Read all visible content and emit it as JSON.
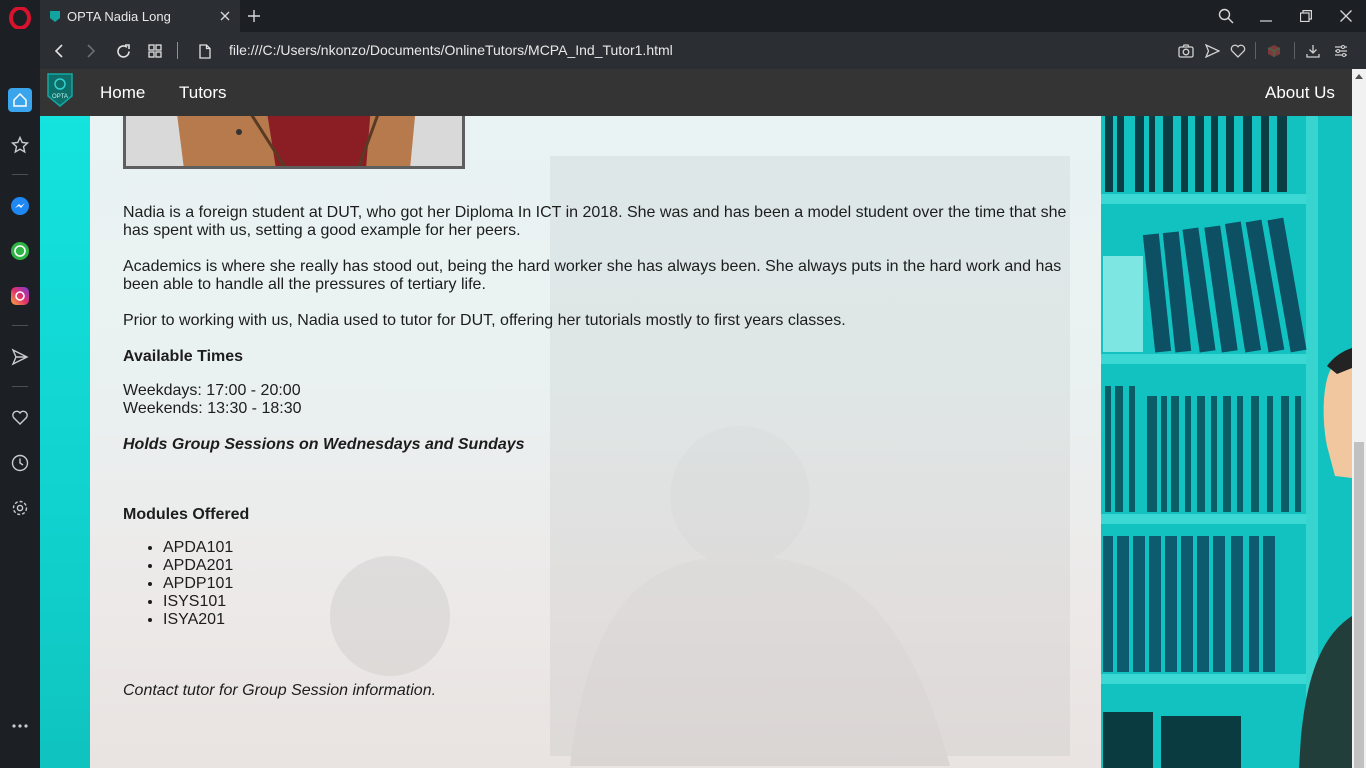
{
  "browser": {
    "tab_title": "OPTA Nadia Long",
    "url": "file:///C:/Users/nkonzo/Documents/OnlineTutors/MCPA_Ind_Tutor1.html",
    "accent": "#d9132d"
  },
  "sidebar": {
    "items": [
      "home-icon",
      "star-icon",
      "messenger-icon",
      "whatsapp-icon",
      "instagram-icon",
      "send-icon",
      "heart-icon",
      "history-icon",
      "settings-icon",
      "more-icon"
    ]
  },
  "site": {
    "logo_text": "OPTA",
    "nav": {
      "home": "Home",
      "tutors": "Tutors",
      "about": "About Us"
    }
  },
  "tutor": {
    "bio": [
      "Nadia is a foreign student at DUT, who got her Diploma In ICT in 2018. She was and has been a model student over the time that she has spent with us, setting a good example for her peers.",
      "Academics is where she really has stood out, being the hard worker she has always been. She always puts in the hard work and has been able to handle all the pressures of tertiary life.",
      "Prior to working with us, Nadia used to tutor for DUT, offering her tutorials mostly to first years classes."
    ],
    "times_heading": "Available Times",
    "weekdays": "Weekdays: 17:00 - 20:00",
    "weekends": "Weekends: 13:30 - 18:30",
    "group_note": "Holds Group Sessions on Wednesdays and Sundays",
    "modules_heading": "Modules Offered",
    "modules": [
      "APDA101",
      "APDA201",
      "APDP101",
      "ISYS101",
      "ISYA201"
    ],
    "contact_note": "Contact tutor for Group Session information."
  }
}
